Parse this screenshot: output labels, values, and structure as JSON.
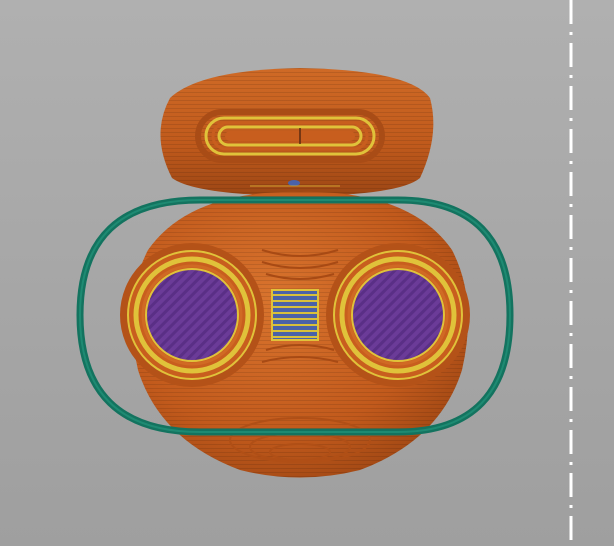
{
  "viewport": {
    "background_top": "#b0b0b0",
    "background_bottom": "#9f9f9f"
  },
  "model": {
    "layer_colors": {
      "perimeter": "#c85e1e",
      "perimeter_dark": "#a84a14",
      "perimeter_light": "#d9742e",
      "external_perimeter": "#e0c23a",
      "solid_infill": "#6a3a96",
      "gap_fill": "#4a62a8",
      "skirt": "#13735f"
    }
  },
  "bed": {
    "edge_color": "#ffffff",
    "edge_style": "dash-dot"
  }
}
